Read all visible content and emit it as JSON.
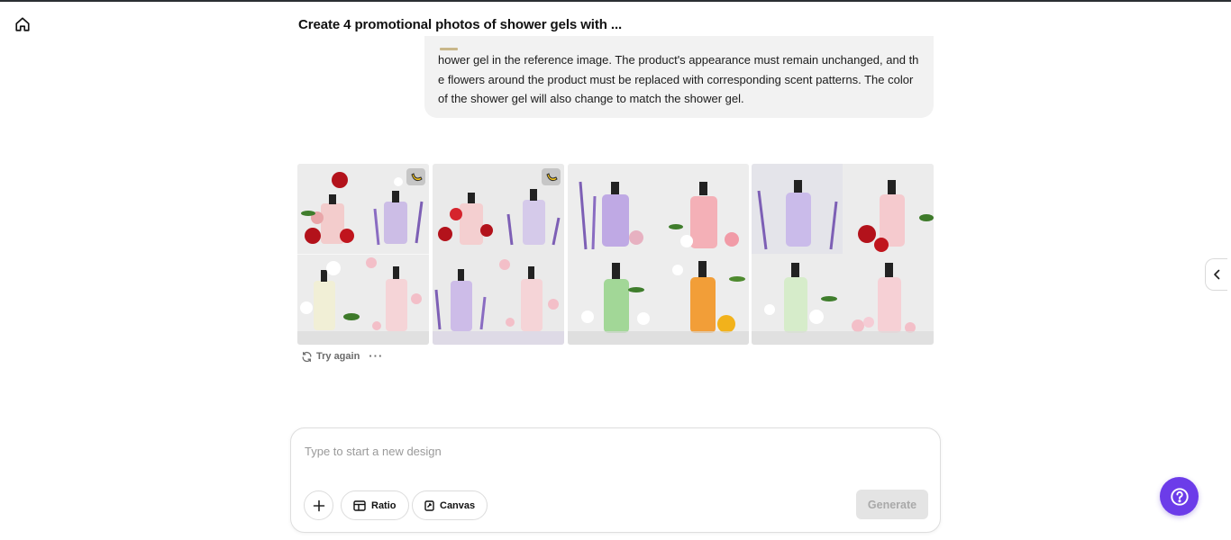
{
  "header": {
    "title": "Create 4 promotional photos of shower gels with ...",
    "home_icon": "home-icon"
  },
  "message": {
    "lines": [
      "hower gel in the reference image. The product's appearance must remain unchanged, and th",
      "e flowers around the product must be replaced with corresponding scent patterns. The color",
      "of the shower gel will also change to match the shower gel."
    ]
  },
  "results": {
    "images": [
      {
        "name": "result-image-1",
        "badge": "banana-icon",
        "scents": [
          "rose",
          "lavender",
          "lily",
          "cherry-blossom"
        ]
      },
      {
        "name": "result-image-2",
        "badge": "banana-icon",
        "scents": [
          "rose",
          "lavender",
          "lavender",
          "cherry-blossom"
        ]
      },
      {
        "name": "result-image-3",
        "badge": "",
        "scents": [
          "lavender",
          "rose",
          "jasmine",
          "orange-blossom"
        ]
      },
      {
        "name": "result-image-4",
        "badge": "",
        "scents": [
          "lavender",
          "rose",
          "jasmine",
          "cherry-blossom"
        ]
      }
    ],
    "try_again_label": "Try again",
    "more_label": "···"
  },
  "composer": {
    "placeholder": "Type to start a new design",
    "ratio_label": "Ratio",
    "canvas_label": "Canvas",
    "generate_label": "Generate"
  },
  "colors": {
    "accent": "#6c3ce9",
    "bubble_bg": "#f2f2f2",
    "generate_disabled_bg": "#e4e4e4"
  }
}
